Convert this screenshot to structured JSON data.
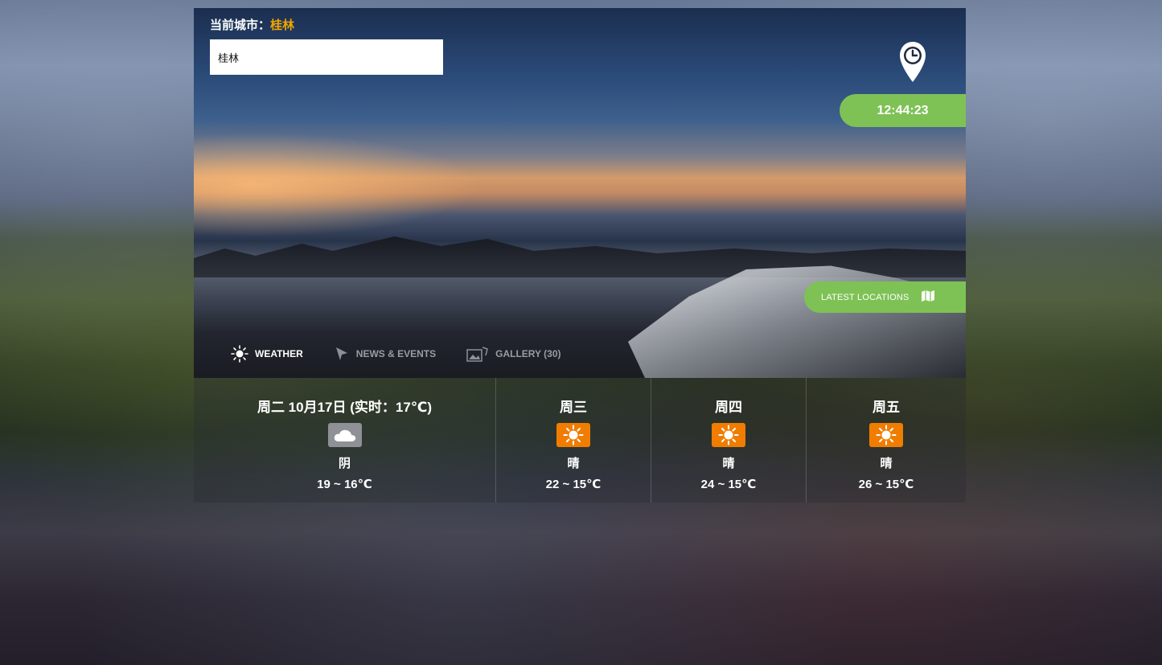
{
  "header": {
    "city_label": "当前城市：",
    "city_name": "桂林"
  },
  "search": {
    "value": "桂林",
    "placeholder": ""
  },
  "clock": {
    "time": "12:44:23",
    "icon": "clock-pin-icon"
  },
  "locations_button": {
    "label": "LATEST LOCATIONS",
    "icon": "map-icon"
  },
  "tabs": [
    {
      "label": "WEATHER",
      "icon": "sun-icon",
      "active": true
    },
    {
      "label": "NEWS & EVENTS",
      "icon": "cursor-icon",
      "active": false
    },
    {
      "label": "GALLERY (30)",
      "icon": "gallery-icon",
      "active": false
    }
  ],
  "forecast": [
    {
      "day": "周二 10月17日 (实时：17℃)",
      "condition": "阴",
      "temp": "19 ~ 16℃",
      "icon": "cloud-icon"
    },
    {
      "day": "周三",
      "condition": "晴",
      "temp": "22 ~ 15℃",
      "icon": "sun-icon"
    },
    {
      "day": "周四",
      "condition": "晴",
      "temp": "24 ~ 15℃",
      "icon": "sun-icon"
    },
    {
      "day": "周五",
      "condition": "晴",
      "temp": "26 ~ 15℃",
      "icon": "sun-icon"
    }
  ],
  "colors": {
    "accent_green": "#7ec256",
    "city_highlight": "#f0a500",
    "sunny_badge": "#f07d00",
    "cloudy_badge": "#8f9196"
  }
}
